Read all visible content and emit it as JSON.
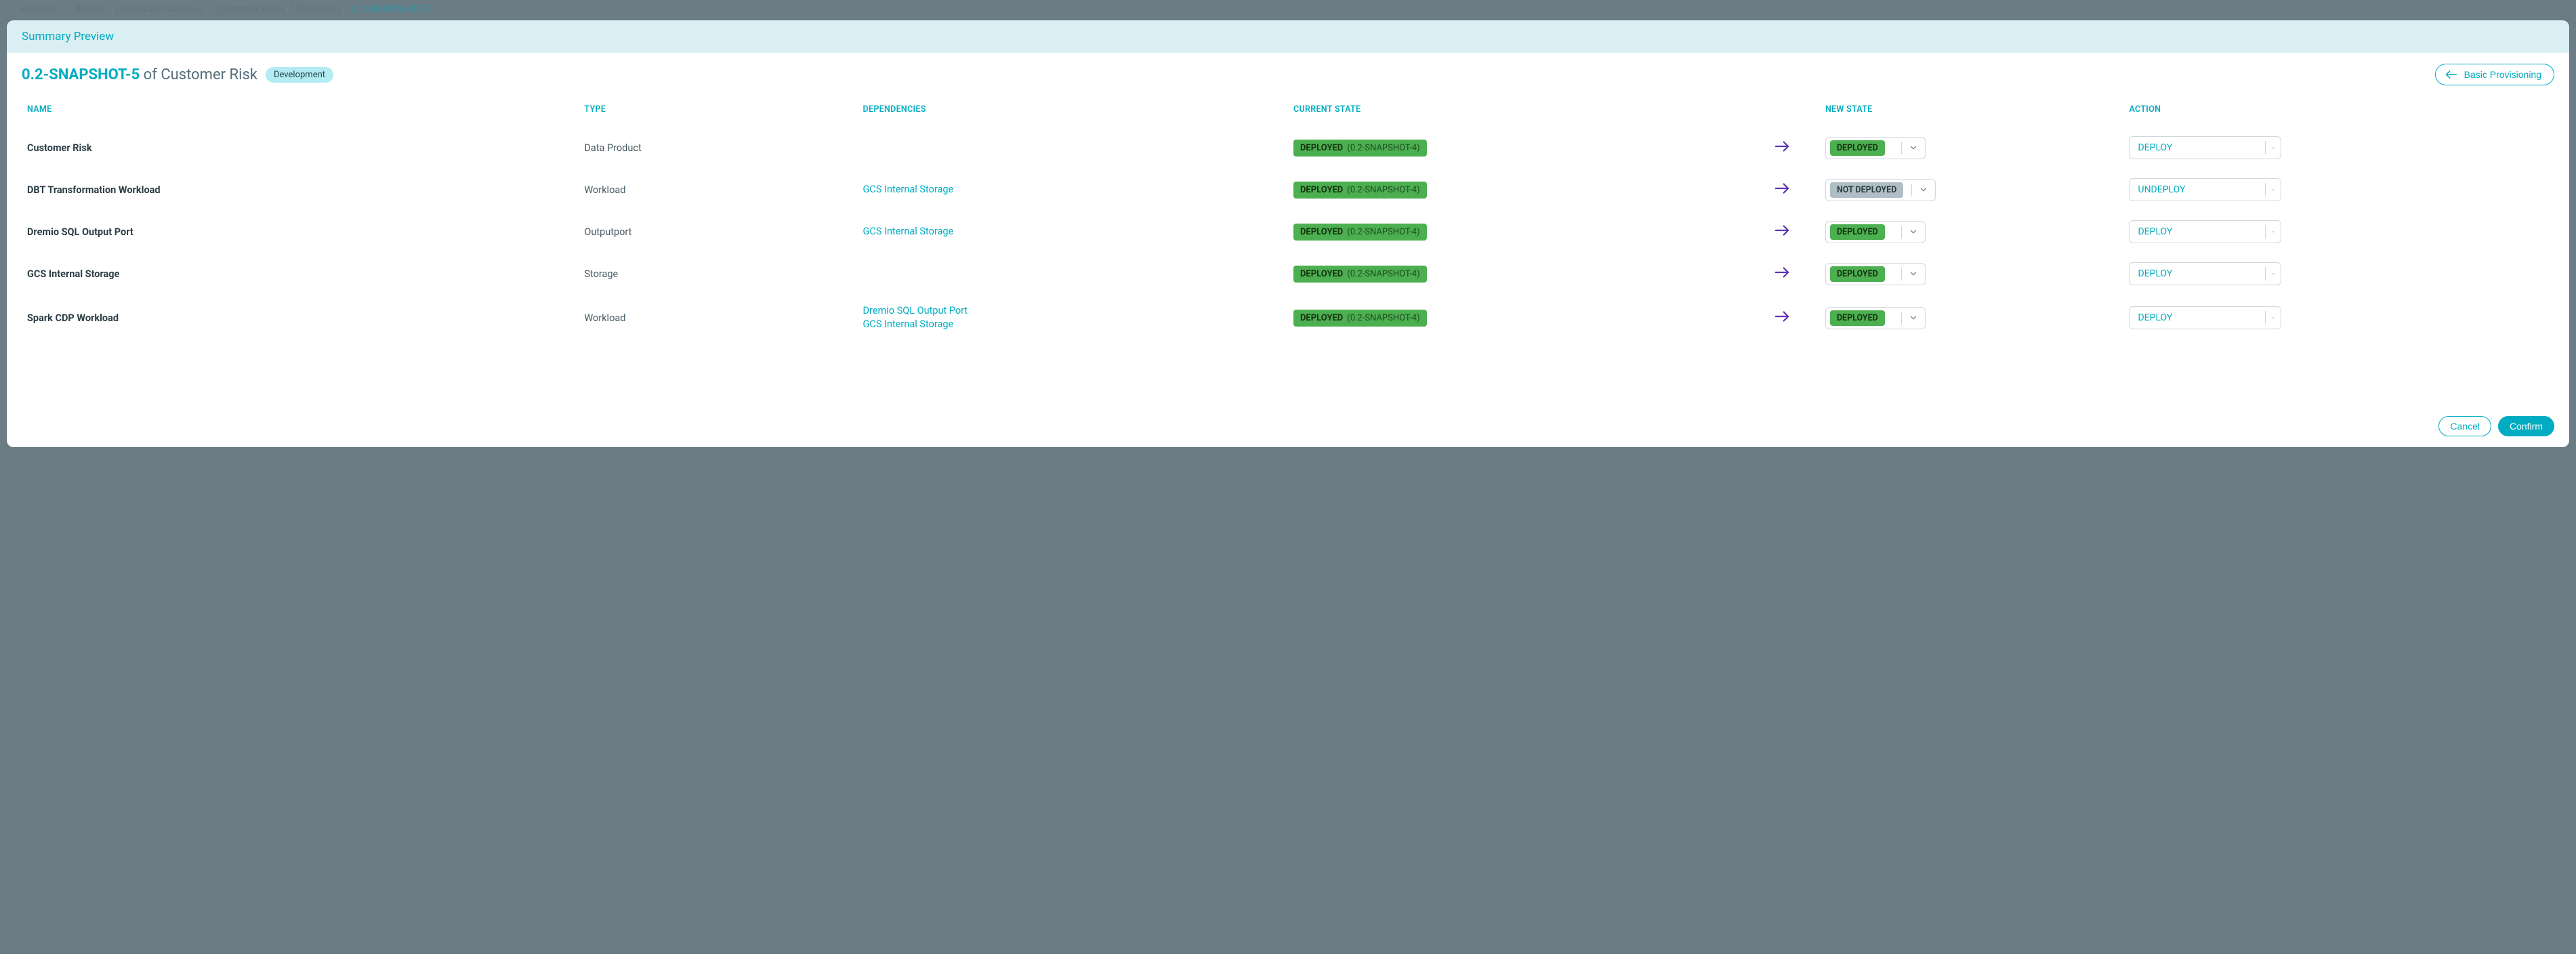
{
  "breadcrumb": {
    "items": [
      "witboost",
      "Builder",
      "Software Catalog",
      "Customer Risk",
      "Releases"
    ],
    "current": "0.2-SNAPSHOT-5"
  },
  "panel": {
    "header": "Summary Preview",
    "title_version": "0.2-SNAPSHOT-5",
    "title_of": "of",
    "title_product": "Customer Risk",
    "env_chip": "Development",
    "basic_provisioning": "Basic Provisioning"
  },
  "columns": {
    "name": "NAME",
    "type": "TYPE",
    "deps": "DEPENDENCIES",
    "current": "CURRENT STATE",
    "newstate": "NEW STATE",
    "action": "ACTION"
  },
  "rows": [
    {
      "name": "Customer Risk",
      "type": "Data Product",
      "deps": [],
      "cur_state": "DEPLOYED",
      "cur_ver": "(0.2-SNAPSHOT-4)",
      "new_state": "DEPLOYED",
      "new_kind": "deployed",
      "action": "DEPLOY"
    },
    {
      "name": "DBT Transformation Workload",
      "type": "Workload",
      "deps": [
        "GCS Internal Storage"
      ],
      "cur_state": "DEPLOYED",
      "cur_ver": "(0.2-SNAPSHOT-4)",
      "new_state": "NOT DEPLOYED",
      "new_kind": "notdeployed",
      "action": "UNDEPLOY"
    },
    {
      "name": "Dremio SQL Output Port",
      "type": "Outputport",
      "deps": [
        "GCS Internal Storage"
      ],
      "cur_state": "DEPLOYED",
      "cur_ver": "(0.2-SNAPSHOT-4)",
      "new_state": "DEPLOYED",
      "new_kind": "deployed",
      "action": "DEPLOY"
    },
    {
      "name": "GCS Internal Storage",
      "type": "Storage",
      "deps": [],
      "cur_state": "DEPLOYED",
      "cur_ver": "(0.2-SNAPSHOT-4)",
      "new_state": "DEPLOYED",
      "new_kind": "deployed",
      "action": "DEPLOY"
    },
    {
      "name": "Spark CDP Workload",
      "type": "Workload",
      "deps": [
        "Dremio SQL Output Port",
        "GCS Internal Storage"
      ],
      "cur_state": "DEPLOYED",
      "cur_ver": "(0.2-SNAPSHOT-4)",
      "new_state": "DEPLOYED",
      "new_kind": "deployed",
      "action": "DEPLOY"
    }
  ],
  "footer": {
    "cancel": "Cancel",
    "confirm": "Confirm"
  }
}
